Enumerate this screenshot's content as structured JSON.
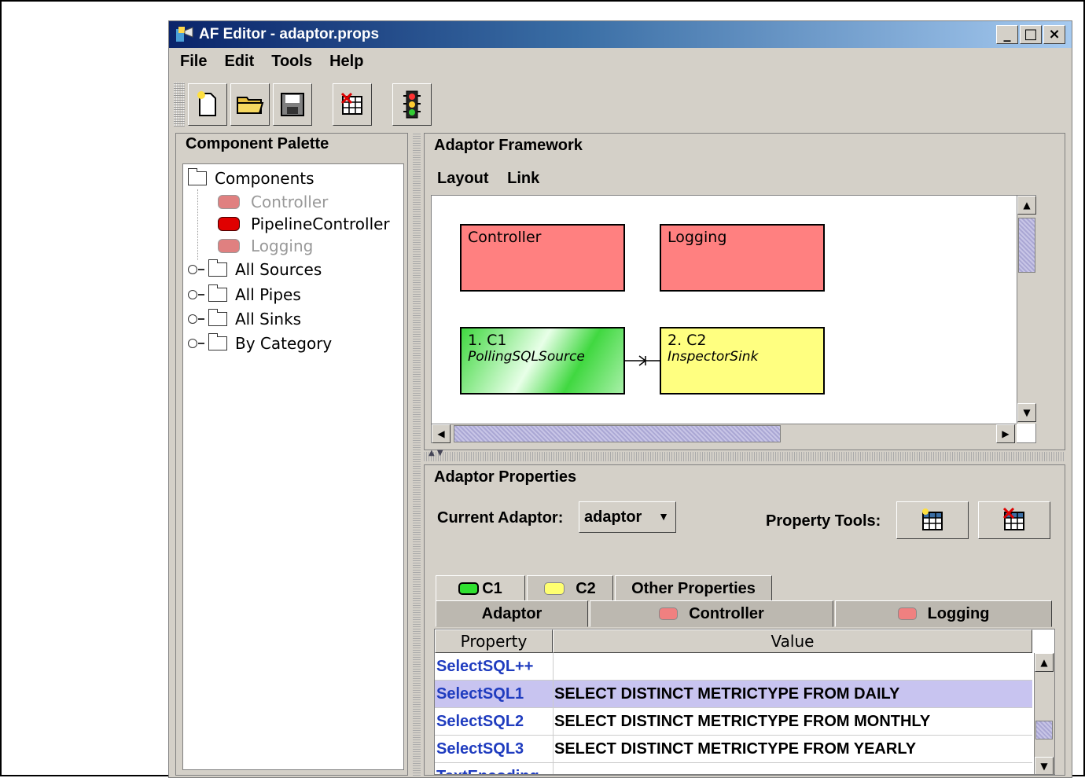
{
  "window": {
    "title": "AF Editor - adaptor.props",
    "buttons": [
      "_",
      "□",
      "×"
    ]
  },
  "menu": [
    "File",
    "Edit",
    "Tools",
    "Help"
  ],
  "toolbar": {
    "buttons": [
      "new-file-icon",
      "open-folder-icon",
      "save-icon",
      "delete-table-icon",
      "traffic-light-icon"
    ]
  },
  "palette": {
    "title": "Component Palette",
    "root": "Components",
    "items": [
      {
        "label": "Controller",
        "color": "#e06060",
        "enabled": false
      },
      {
        "label": "PipelineController",
        "color": "#e00000",
        "enabled": true
      },
      {
        "label": "Logging",
        "color": "#e06060",
        "enabled": false
      }
    ],
    "folders": [
      "All Sources",
      "All Pipes",
      "All Sinks",
      "By Category"
    ]
  },
  "framework": {
    "title": "Adaptor Framework",
    "menu": [
      "Layout",
      "Link"
    ],
    "components": [
      {
        "name": "Controller",
        "subtitle": "",
        "color": "#ff8080"
      },
      {
        "name": "Logging",
        "subtitle": "",
        "color": "#ff8080"
      },
      {
        "name": "1. C1",
        "subtitle": "PollingSQLSource",
        "color": "#66ee66"
      },
      {
        "name": "2. C2",
        "subtitle": "InspectorSink",
        "color": "#ffff80"
      }
    ]
  },
  "properties": {
    "title": "Adaptor Properties",
    "current_adaptor_label": "Current Adaptor:",
    "current_adaptor_value": "adaptor",
    "property_tools_label": "Property Tools:",
    "tabs_row1": [
      "C1",
      "C2",
      "Other Properties"
    ],
    "tabs_row2": [
      "Adaptor",
      "Controller",
      "Logging"
    ],
    "columns": [
      "Property",
      "Value"
    ],
    "rows": [
      {
        "key": "SelectSQL++",
        "value": "",
        "selected": false
      },
      {
        "key": "SelectSQL1",
        "value": "SELECT DISTINCT METRICTYPE FROM DAILY",
        "selected": true
      },
      {
        "key": "SelectSQL2",
        "value": "SELECT DISTINCT METRICTYPE FROM MONTHLY",
        "selected": false
      },
      {
        "key": "SelectSQL3",
        "value": "SELECT DISTINCT METRICTYPE FROM YEARLY",
        "selected": false
      }
    ],
    "partial_row": "TextEncoding"
  }
}
